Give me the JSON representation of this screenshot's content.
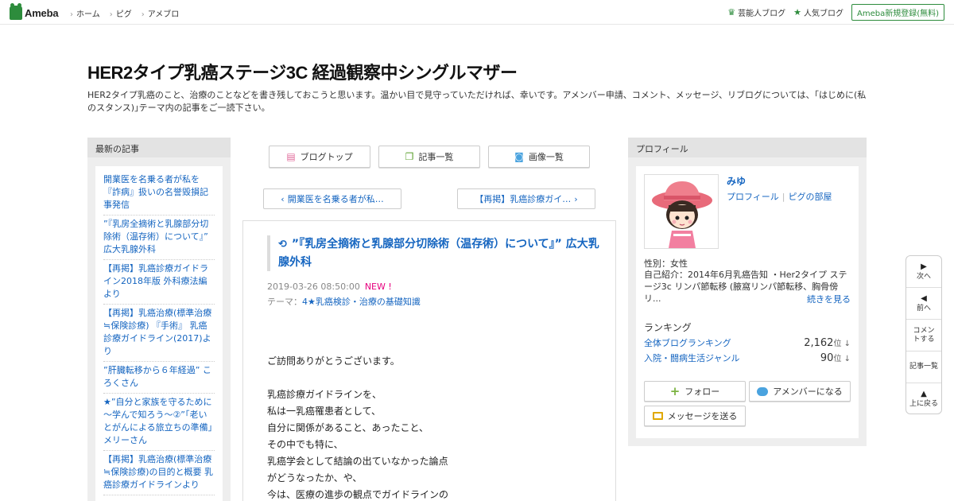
{
  "header": {
    "logo_text": "Ameba",
    "nav": [
      "ホーム",
      "ピグ",
      "アメブロ"
    ],
    "celebrity_blog": "芸能人ブログ",
    "popular_blog": "人気ブログ",
    "register": "Ameba新規登録(無料)"
  },
  "blog": {
    "title": "HER2タイプ乳癌ステージ3C 経過観察中シングルマザー",
    "description": "HER2タイプ乳癌のこと、治療のことなどを書き残しておこうと思います。温かい目で見守っていただければ、幸いです。アメンバー申請、コメント、メッセージ、リブログについては、｢はじめに(私のスタンス)｣テーマ内の記事をご一読下さい。"
  },
  "recent": {
    "heading": "最新の記事",
    "items": [
      "開業医を名乗る者が私を『詐病』扱いの名誉毀損記事発信",
      "”『乳房全摘術と乳腺部分切除術（温存術）について』” 広大乳腺外科",
      "【再掲】乳癌診療ガイドライン2018年版 外科療法編より",
      "【再掲】乳癌治療(標準治療≒保険診療) 『手術』 乳癌診療ガイドライン(2017)より",
      "”肝臓転移から６年経過” ころくさん",
      "★”自分と家族を守るために～学んで知ろう～②”「老いとがんによる旅立ちの準備」メリーさん",
      "【再掲】乳癌治療(標準治療≒保険診療)の目的と概要 乳癌診療ガイドラインより"
    ]
  },
  "center_nav": {
    "blog_top": "ブログトップ",
    "article_list": "記事一覧",
    "image_list": "画像一覧"
  },
  "pager": {
    "prev": "開業医を名乗る者が私…",
    "next": "【再掲】乳癌診療ガイ…"
  },
  "article": {
    "title": "”『乳房全摘術と乳腺部分切除術（温存術）について』” 広大乳腺外科",
    "date": "2019-03-26 08:50:00",
    "new_badge": "NEW !",
    "theme_label": "テーマ：",
    "theme": "4★乳癌検診・治療の基礎知識",
    "body": [
      "ご訪問ありがとうございます。",
      "",
      "乳癌診療ガイドラインを、",
      "私は一乳癌罹患者として、",
      "自分に関係があること、あったこと、",
      "その中でも特に、",
      "乳癌学会として結論の出ていなかった論点",
      "がどうなったか、や、",
      "今は、医療の進歩の観点でガイドラインの"
    ]
  },
  "profile": {
    "heading": "プロフィール",
    "name": "みゆ",
    "profile_link": "プロフィール",
    "pigg_link": "ピグの部屋",
    "sex": "性別：女性",
    "intro": "自己紹介：2014年6月乳癌告知 ・Her2タイプ ステージ3c リンパ節転移 (腋窩リンパ節転移、胸骨傍リ...",
    "more": "続きを見る",
    "ranking_heading": "ランキング",
    "rank_overall_label": "全体ブログランキング",
    "rank_overall_value": "2,162",
    "rank_genre_label": "入院・闘病生活ジャンル",
    "rank_genre_value": "90",
    "rank_unit": "位 ↓",
    "follow": "フォロー",
    "amember": "アメンバーになる",
    "message": "メッセージを送る"
  },
  "sidenav": {
    "next": "次へ",
    "prev": "前へ",
    "comment": "コメントする",
    "list": "記事一覧",
    "top": "上に戻る"
  }
}
